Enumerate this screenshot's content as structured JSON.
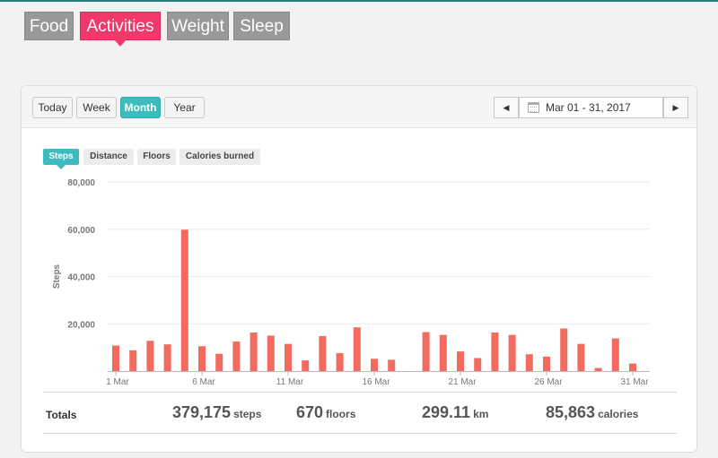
{
  "main_tabs": [
    {
      "label": "Food",
      "active": false
    },
    {
      "label": "Activities",
      "active": true
    },
    {
      "label": "Weight",
      "active": false
    },
    {
      "label": "Sleep",
      "active": false
    }
  ],
  "period_buttons": [
    {
      "label": "Today",
      "active": false
    },
    {
      "label": "Week",
      "active": false
    },
    {
      "label": "Month",
      "active": true
    },
    {
      "label": "Year",
      "active": false
    }
  ],
  "date_range": "Mar 01 - 31, 2017",
  "nav_prev": "◀",
  "nav_next": "▶",
  "metric_tabs": [
    {
      "label": "Steps",
      "active": true
    },
    {
      "label": "Distance",
      "active": false
    },
    {
      "label": "Floors",
      "active": false
    },
    {
      "label": "Calories burned",
      "active": false
    }
  ],
  "colors": {
    "bar": "#f36b5e",
    "accent": "#3dbcbf",
    "active_main_tab": "#f0386b"
  },
  "chart_data": {
    "type": "bar",
    "ylabel": "Steps",
    "ylim": [
      0,
      80000
    ],
    "yticks": [
      "80,000",
      "60,000",
      "40,000",
      "20,000"
    ],
    "ytick_values": [
      80000,
      60000,
      40000,
      20000
    ],
    "xtick_labels": [
      "1 Mar",
      "6 Mar",
      "11 Mar",
      "16 Mar",
      "21 Mar",
      "26 Mar",
      "31 Mar"
    ],
    "xtick_days": [
      1,
      6,
      11,
      16,
      21,
      26,
      31
    ],
    "days": [
      1,
      2,
      3,
      4,
      5,
      6,
      7,
      8,
      9,
      10,
      11,
      12,
      13,
      14,
      15,
      16,
      17,
      18,
      19,
      20,
      21,
      22,
      23,
      24,
      25,
      26,
      27,
      28,
      29,
      30,
      31
    ],
    "values": [
      10800,
      8800,
      12800,
      11300,
      59800,
      10500,
      7300,
      12500,
      16300,
      15000,
      11500,
      4500,
      14800,
      7600,
      18500,
      5200,
      4800,
      0,
      16500,
      15300,
      8300,
      5500,
      16300,
      15300,
      7100,
      6100,
      18000,
      11500,
      1300,
      13800,
      3200
    ]
  },
  "totals": {
    "label": "Totals",
    "steps": {
      "value": "379,175",
      "unit": "steps"
    },
    "floors": {
      "value": "670",
      "unit": "floors"
    },
    "distance": {
      "value": "299.11",
      "unit": "km"
    },
    "calories": {
      "value": "85,863",
      "unit": "calories"
    }
  }
}
